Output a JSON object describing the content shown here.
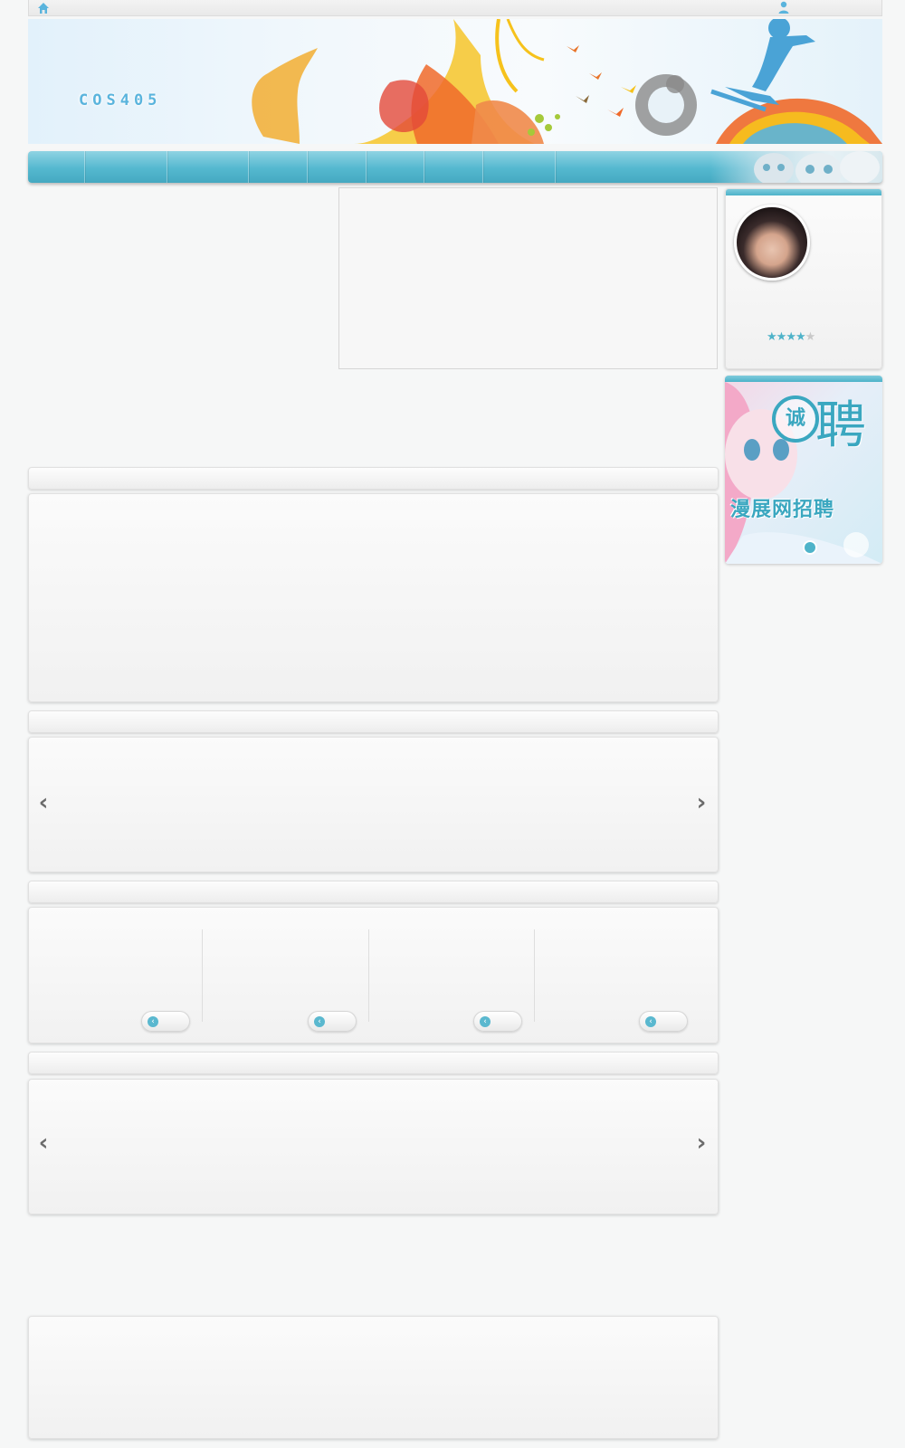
{
  "topbar": {
    "home_icon": "home-icon",
    "user_icon": "user-icon",
    "accent": "#5ab4dd"
  },
  "banner": {
    "logo_text": "COS405"
  },
  "navbar": {
    "accent": "#54b8cf",
    "item_count": 9
  },
  "sidebar": {
    "profile": {
      "rating": 4,
      "rating_max": 5
    },
    "recruit": {
      "circle_text": "诚",
      "big_text": "聘",
      "caption": "漫展网招聘"
    }
  },
  "sections": [
    {
      "name": "section-1"
    },
    {
      "name": "section-2-carousel",
      "prev": "‹",
      "next": "›"
    },
    {
      "name": "section-3-columns"
    },
    {
      "name": "section-4-carousel",
      "prev": "‹",
      "next": "›"
    }
  ]
}
